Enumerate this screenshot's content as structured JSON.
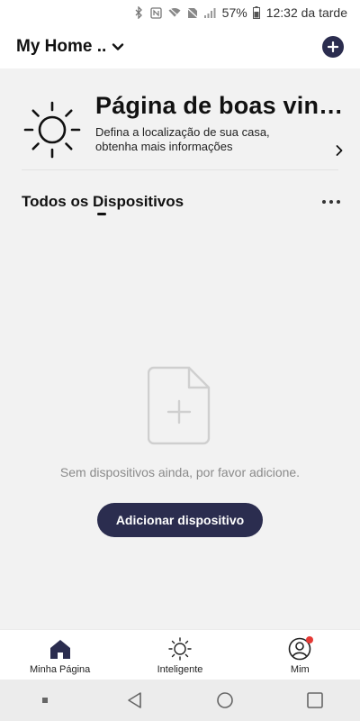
{
  "status_bar": {
    "icons": [
      "bluetooth-icon",
      "nfc-icon",
      "wifi-icon",
      "no-sim-icon",
      "signal-icon"
    ],
    "battery": "57%",
    "time": "12:32 da tarde"
  },
  "header": {
    "home_name": "My Home ..",
    "add_icon": "plus-circle-icon"
  },
  "welcome": {
    "title": "Página de boas vindas",
    "subtitle": "Defina a localização de sua casa, obtenha mais informações",
    "icon": "sun-icon"
  },
  "tabs": {
    "all_devices": "Todos os Dispositivos"
  },
  "empty_state": {
    "message": "Sem dispositivos ainda, por favor adicione.",
    "button_label": "Adicionar dispositivo"
  },
  "bottom_nav": {
    "items": [
      {
        "label": "Minha Página",
        "icon": "home-icon"
      },
      {
        "label": "Inteligente",
        "icon": "sun-icon"
      },
      {
        "label": "Mim",
        "icon": "user-icon"
      }
    ]
  },
  "colors": {
    "primary": "#2b2d4f",
    "background": "#f2f2f2",
    "badge": "#e53935",
    "muted_text": "#8a8a8a"
  }
}
